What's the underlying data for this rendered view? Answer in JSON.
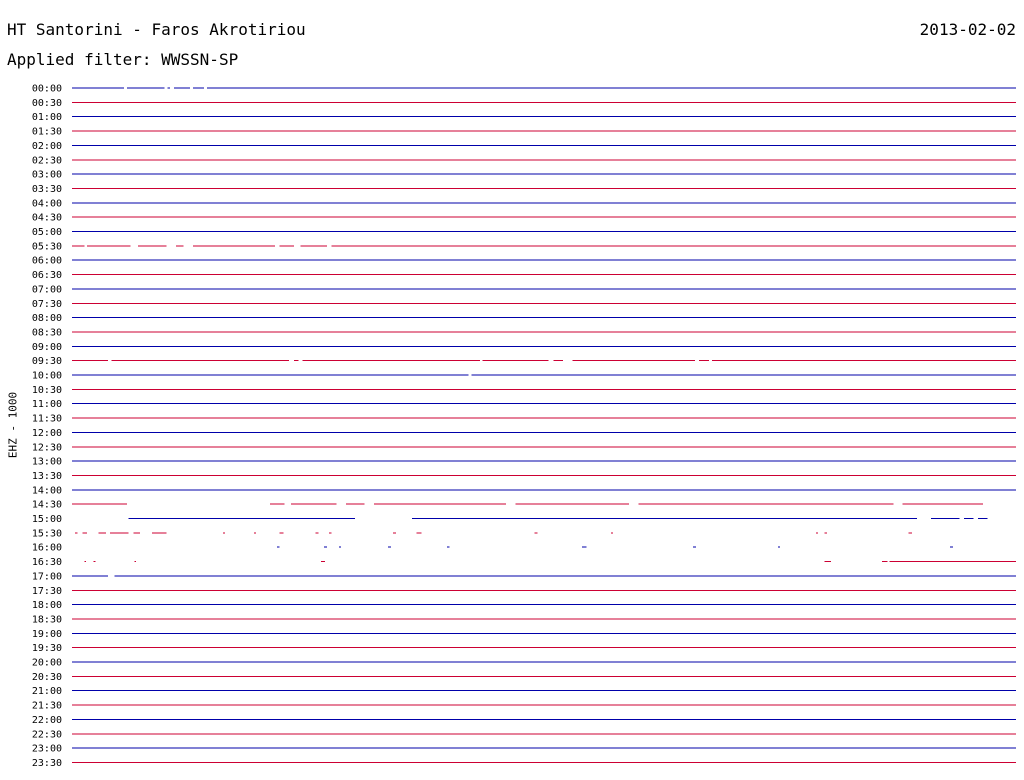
{
  "header": {
    "station": "HT Santorini - Faros Akrotiriou",
    "date": "2013-02-02",
    "filter_prefix": "Applied filter:",
    "filter": "WWSSN-SP"
  },
  "colors": {
    "even_row": "#0000aa",
    "odd_row": "#cc0033",
    "background": "#ffffff"
  },
  "chart_data": {
    "type": "line",
    "title": "HT Santorini - Faros Akrotiriou",
    "ylabel": "EHZ - 1000",
    "xlabel": "",
    "row_interval_minutes": 30,
    "rows": [
      {
        "label": "00:00",
        "gaps": [
          [
            0.055,
            0.058
          ],
          [
            0.098,
            0.101
          ],
          [
            0.104,
            0.108
          ],
          [
            0.125,
            0.128
          ],
          [
            0.14,
            0.143
          ]
        ]
      },
      {
        "label": "00:30",
        "gaps": []
      },
      {
        "label": "01:00",
        "gaps": []
      },
      {
        "label": "01:30",
        "gaps": []
      },
      {
        "label": "02:00",
        "gaps": []
      },
      {
        "label": "02:30",
        "gaps": []
      },
      {
        "label": "03:00",
        "gaps": []
      },
      {
        "label": "03:30",
        "gaps": []
      },
      {
        "label": "04:00",
        "gaps": []
      },
      {
        "label": "04:30",
        "gaps": []
      },
      {
        "label": "05:00",
        "gaps": []
      },
      {
        "label": "05:30",
        "gaps": [
          [
            0.013,
            0.016
          ],
          [
            0.062,
            0.07
          ],
          [
            0.1,
            0.11
          ],
          [
            0.118,
            0.128
          ],
          [
            0.215,
            0.22
          ],
          [
            0.235,
            0.242
          ],
          [
            0.27,
            0.275
          ]
        ]
      },
      {
        "label": "06:00",
        "gaps": []
      },
      {
        "label": "06:30",
        "gaps": []
      },
      {
        "label": "07:00",
        "gaps": []
      },
      {
        "label": "07:30",
        "gaps": []
      },
      {
        "label": "08:00",
        "gaps": []
      },
      {
        "label": "08:30",
        "gaps": []
      },
      {
        "label": "09:00",
        "gaps": []
      },
      {
        "label": "09:30",
        "gaps": [
          [
            0.038,
            0.042
          ],
          [
            0.23,
            0.235
          ],
          [
            0.24,
            0.244
          ],
          [
            0.432,
            0.435
          ],
          [
            0.505,
            0.51
          ],
          [
            0.52,
            0.53
          ],
          [
            0.66,
            0.664
          ],
          [
            0.675,
            0.678
          ]
        ]
      },
      {
        "label": "10:00",
        "gaps": [
          [
            0.42,
            0.423
          ]
        ]
      },
      {
        "label": "10:30",
        "gaps": []
      },
      {
        "label": "11:00",
        "gaps": []
      },
      {
        "label": "11:30",
        "gaps": []
      },
      {
        "label": "12:00",
        "gaps": []
      },
      {
        "label": "12:30",
        "gaps": []
      },
      {
        "label": "13:00",
        "gaps": []
      },
      {
        "label": "13:30",
        "gaps": []
      },
      {
        "label": "14:00",
        "gaps": []
      },
      {
        "label": "14:30",
        "gaps": [
          [
            0.058,
            0.21
          ],
          [
            0.225,
            0.232
          ],
          [
            0.28,
            0.29
          ],
          [
            0.31,
            0.32
          ],
          [
            0.46,
            0.47
          ],
          [
            0.59,
            0.6
          ],
          [
            0.87,
            0.88
          ],
          [
            0.965,
            1.0
          ]
        ]
      },
      {
        "label": "15:00",
        "gaps": [
          [
            0.0,
            0.06
          ],
          [
            0.3,
            0.36
          ],
          [
            0.895,
            0.91
          ],
          [
            0.94,
            0.945
          ],
          [
            0.955,
            0.96
          ],
          [
            0.97,
            1.0
          ]
        ]
      },
      {
        "label": "15:30",
        "segments": [
          [
            0.003,
            0.006
          ],
          [
            0.011,
            0.016
          ],
          [
            0.028,
            0.036
          ],
          [
            0.04,
            0.06
          ],
          [
            0.065,
            0.072
          ],
          [
            0.085,
            0.1
          ],
          [
            0.16,
            0.162
          ],
          [
            0.193,
            0.195
          ],
          [
            0.22,
            0.224
          ],
          [
            0.258,
            0.261
          ],
          [
            0.272,
            0.275
          ],
          [
            0.34,
            0.343
          ],
          [
            0.365,
            0.37
          ],
          [
            0.49,
            0.493
          ],
          [
            0.571,
            0.573
          ],
          [
            0.788,
            0.79
          ],
          [
            0.797,
            0.8
          ],
          [
            0.886,
            0.89
          ]
        ]
      },
      {
        "label": "16:00",
        "segments": [
          [
            0.217,
            0.22
          ],
          [
            0.267,
            0.27
          ],
          [
            0.283,
            0.285
          ],
          [
            0.335,
            0.338
          ],
          [
            0.397,
            0.4
          ],
          [
            0.54,
            0.545
          ],
          [
            0.658,
            0.661
          ],
          [
            0.748,
            0.75
          ],
          [
            0.93,
            0.933
          ]
        ]
      },
      {
        "label": "16:30",
        "segments": [
          [
            0.013,
            0.015
          ],
          [
            0.023,
            0.025
          ],
          [
            0.066,
            0.068
          ],
          [
            0.264,
            0.268
          ],
          [
            0.797,
            0.804
          ],
          [
            0.858,
            0.864
          ],
          [
            0.866,
            1.0
          ]
        ]
      },
      {
        "label": "17:00",
        "segments": [
          [
            0.0,
            0.038
          ],
          [
            0.045,
            1.0
          ]
        ]
      },
      {
        "label": "17:30",
        "gaps": []
      },
      {
        "label": "18:00",
        "gaps": []
      },
      {
        "label": "18:30",
        "gaps": []
      },
      {
        "label": "19:00",
        "gaps": []
      },
      {
        "label": "19:30",
        "gaps": []
      },
      {
        "label": "20:00",
        "gaps": []
      },
      {
        "label": "20:30",
        "gaps": []
      },
      {
        "label": "21:00",
        "gaps": []
      },
      {
        "label": "21:30",
        "gaps": []
      },
      {
        "label": "22:00",
        "gaps": []
      },
      {
        "label": "22:30",
        "gaps": []
      },
      {
        "label": "23:00",
        "gaps": []
      },
      {
        "label": "23:30",
        "gaps": []
      }
    ],
    "grid": false,
    "legend": "none"
  }
}
